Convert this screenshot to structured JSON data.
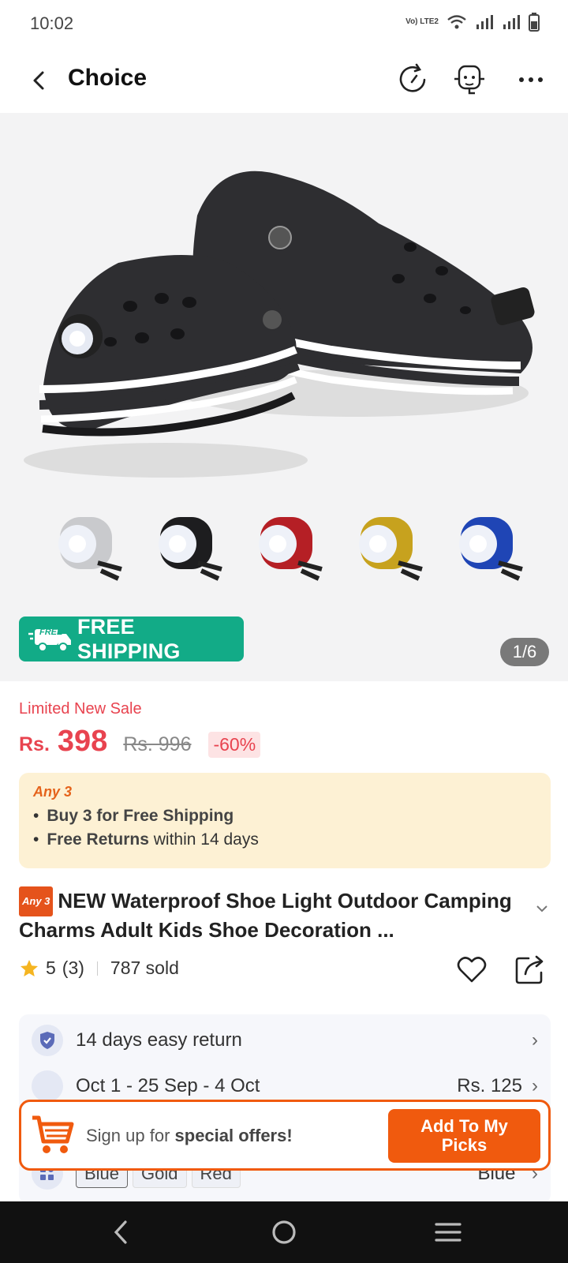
{
  "status_bar": {
    "time": "10:02",
    "network_label": "Vo) LTE2"
  },
  "topbar": {
    "title": "Choice"
  },
  "gallery": {
    "free_shipping_tag": "FREE",
    "free_shipping_label": "FREE SHIPPING",
    "counter": "1/6",
    "light_colors": [
      "#c9cacd",
      "#1d1d1f",
      "#b51f25",
      "#c7a21e",
      "#1f45b5"
    ]
  },
  "price": {
    "sale_label": "Limited New Sale",
    "currency": "Rs.",
    "current": "398",
    "original": "Rs. 996",
    "discount": "-60%"
  },
  "promo": {
    "tag": "Any 3",
    "line1_bold": "Buy 3 for  Free Shipping",
    "line2_bold": "Free Returns",
    "line2_rest": " within 14 days"
  },
  "product": {
    "badge": "Any 3",
    "title": "NEW Waterproof Shoe Light Outdoor Camping Charms Adult Kids Shoe Decoration ...",
    "rating": "5",
    "reviews": "(3)",
    "sold": "787 sold"
  },
  "info": {
    "return_label": "14 days easy return",
    "delivery_partial": "Oct 1 - 25 Sep - 4 Oct",
    "delivery_price_partial": "Rs. 125",
    "colors": [
      "Blue",
      "Gold",
      "Red"
    ],
    "selected_color": "\"Blue\""
  },
  "signup": {
    "text_plain": "Sign up for ",
    "text_bold": "special offers!",
    "button": "Add To My Picks"
  },
  "accent": "#f05a0e",
  "price_color": "#e8434f",
  "shipping_color": "#12ab87"
}
